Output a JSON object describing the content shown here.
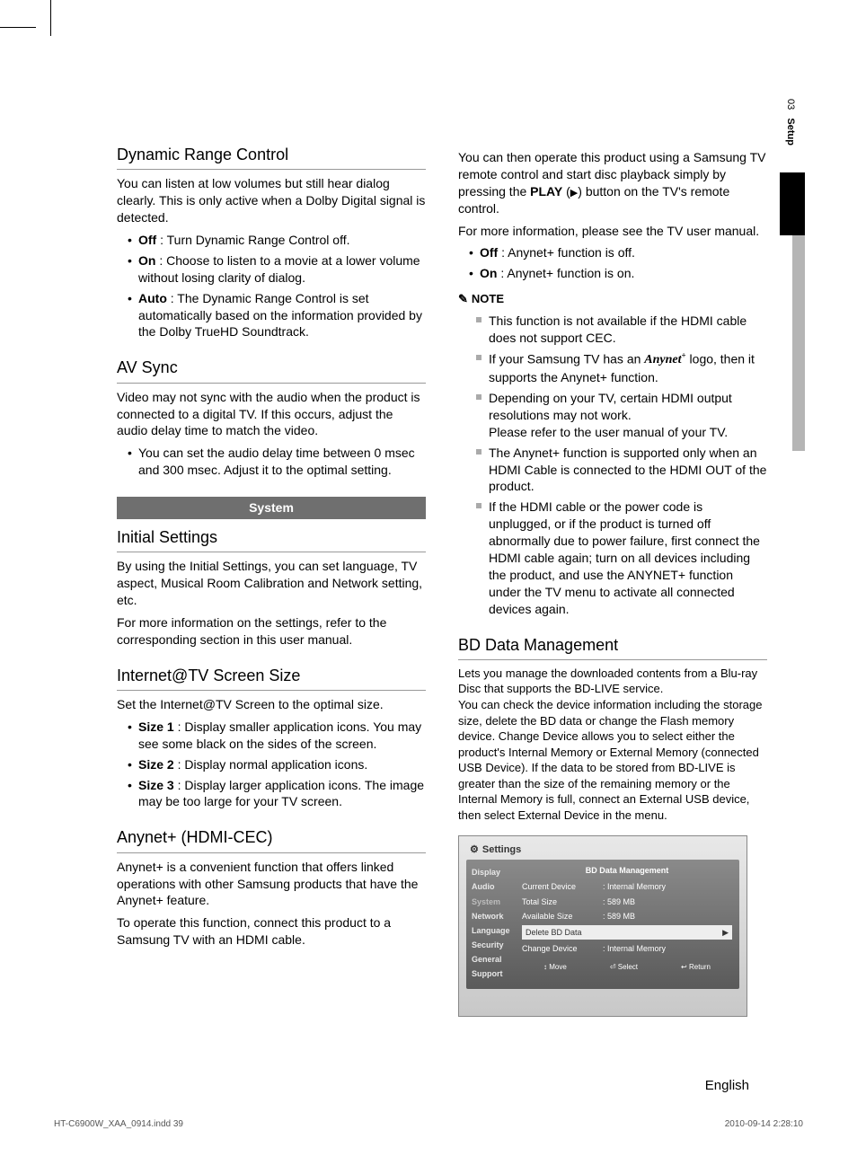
{
  "sideTab": {
    "chapterNum": "03",
    "chapterName": "Setup"
  },
  "col1": {
    "drc": {
      "heading": "Dynamic Range Control",
      "intro": "You can listen at low volumes but still hear dialog clearly. This is only active when a Dolby Digital signal is detected.",
      "items": [
        {
          "b": "Off",
          "t": " : Turn Dynamic Range Control off."
        },
        {
          "b": "On",
          "t": " : Choose to listen to a movie at a lower volume without losing clarity of dialog."
        },
        {
          "b": "Auto",
          "t": " : The Dynamic Range Control is set automatically based on the information provided by the Dolby TrueHD Soundtrack."
        }
      ]
    },
    "av": {
      "heading": "AV Sync",
      "intro": "Video may not sync with the audio when the product is connected to a digital TV. If this occurs, adjust the audio delay time to match the video.",
      "items": [
        "You can set the audio delay time between 0 msec and 300 msec. Adjust it to the optimal setting."
      ]
    },
    "systemTab": "System",
    "initsettings": {
      "heading": "Initial Settings",
      "p1": "By using the Initial Settings, you can set language, TV aspect, Musical Room Calibration and Network setting, etc.",
      "p2": "For more information on the settings, refer to the corresponding section in this user manual."
    },
    "itv": {
      "heading": "Internet@TV Screen Size",
      "intro": "Set the Internet@TV Screen to the optimal size.",
      "items": [
        {
          "b": "Size 1",
          "t": " : Display smaller application icons. You may see some black on the sides of the screen."
        },
        {
          "b": "Size 2",
          "t": " : Display normal application icons."
        },
        {
          "b": "Size 3",
          "t": " : Display larger application icons. The image may be too large for your TV screen."
        }
      ]
    },
    "anynet": {
      "heading": "Anynet+ (HDMI-CEC)",
      "p1": "Anynet+ is a convenient function that offers linked operations with other Samsung products that have the Anynet+ feature.",
      "p2": "To operate this function, connect this product to a Samsung TV with an HDMI cable."
    }
  },
  "col2": {
    "anynetCont": {
      "p1a": "You can then operate this product using a Samsung TV remote control and start disc playback simply by pressing the ",
      "p1b": "PLAY",
      "p1c": " button on the TV's remote control.",
      "p2": "For more information, please see the TV user manual.",
      "items": [
        {
          "b": "Off",
          "t": " : Anynet+ function is off."
        },
        {
          "b": "On",
          "t": " : Anynet+ function is on."
        }
      ],
      "noteLabel": "NOTE",
      "notes": [
        "This function is not available if the HDMI cable does not support CEC.",
        "__ANYNET__",
        "Depending on your TV, certain HDMI output resolutions may not work.\nPlease refer to the user manual of your TV.",
        "The Anynet+ function is supported only when an HDMI Cable is connected to the HDMI OUT of the product.",
        "If the HDMI cable or the power code is unplugged, or if the product is turned off abnormally due to power failure, first connect the HDMI cable again; turn on all devices including the product, and use the ANYNET+ function under the TV menu to activate all connected devices again."
      ],
      "anynetNote_a": "If your Samsung TV has an ",
      "anynetNote_b": " logo, then it supports the Anynet+ function."
    },
    "bd": {
      "heading": "BD Data Management",
      "p": "Lets you manage the downloaded contents from a Blu-ray Disc that supports the BD-LIVE service.\nYou can check the device information including the storage size, delete the BD data or change the Flash memory device. Change Device allows you to select either the product's Internal Memory or External Memory (connected USB Device). If the data to be stored from BD-LIVE is greater than the size of the remaining memory or the Internal Memory is full, connect an External USB device, then select External Device in the menu."
    },
    "shot": {
      "title": "Settings",
      "side": [
        "Display",
        "Audio",
        "System",
        "Network",
        "Language",
        "Security",
        "General",
        "Support"
      ],
      "mainTitle": "BD Data Management",
      "rows": [
        {
          "k": "Current Device",
          "v": ": Internal Memory"
        },
        {
          "k": "Total Size",
          "v": ": 589 MB"
        },
        {
          "k": "Available Size",
          "v": ": 589 MB"
        }
      ],
      "highlight": {
        "k": "Delete BD Data",
        "v": "▶"
      },
      "row4": {
        "k": "Change Device",
        "v": ": Internal Memory"
      },
      "hints": [
        "↕ Move",
        "⏎ Select",
        "↩ Return"
      ]
    }
  },
  "langFooter": "English",
  "footer": {
    "left": "HT-C6900W_XAA_0914.indd   39",
    "right": "2010-09-14   2:28:10"
  }
}
